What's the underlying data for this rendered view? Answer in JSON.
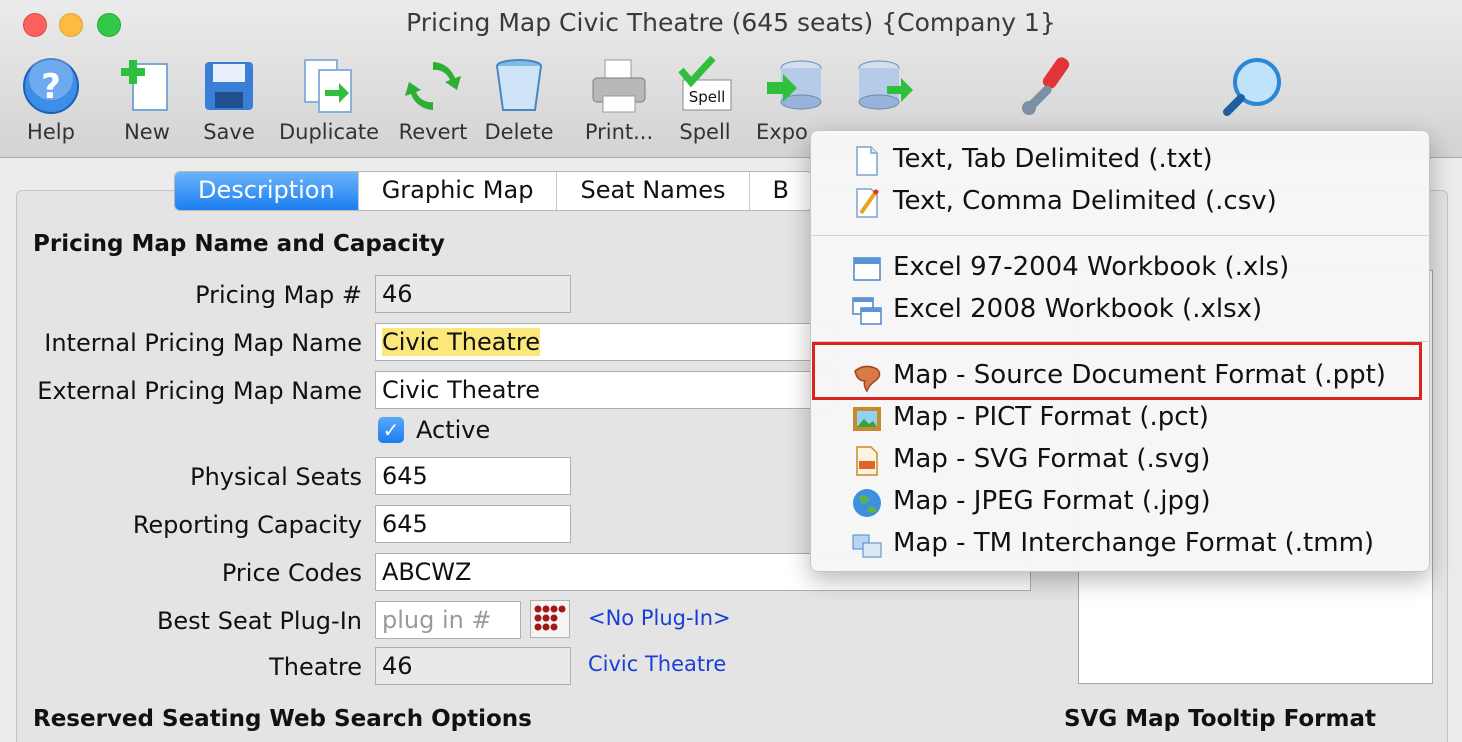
{
  "window": {
    "title": "Pricing Map Civic Theatre (645 seats) {Company 1}"
  },
  "toolbar": {
    "help": "Help",
    "new": "New",
    "save": "Save",
    "duplicate": "Duplicate",
    "revert": "Revert",
    "delete": "Delete",
    "print": "Print...",
    "spell": "Spell",
    "export": "Expo",
    "spell_badge": "Spell"
  },
  "tabs": [
    "Description",
    "Graphic Map",
    "Seat Names",
    "B"
  ],
  "sections": {
    "capacity": "Pricing Map Name and Capacity",
    "web_search": "Reserved Seating Web Search Options",
    "svg_tooltip": "SVG Map Tooltip Format"
  },
  "fields": {
    "pricing_map_no": {
      "label": "Pricing Map #",
      "value": "46"
    },
    "internal_name": {
      "label": "Internal Pricing Map Name",
      "value": "Civic Theatre"
    },
    "external_name": {
      "label": "External Pricing Map Name",
      "value": "Civic Theatre"
    },
    "active": {
      "label": "Active",
      "checked": true
    },
    "physical_seats": {
      "label": "Physical Seats",
      "value": "645"
    },
    "reporting_capacity": {
      "label": "Reporting Capacity",
      "value": "645"
    },
    "price_codes": {
      "label": "Price Codes",
      "value": "ABCWZ"
    },
    "best_seat": {
      "label": "Best Seat Plug-In",
      "placeholder": "plug in #",
      "link": "<No Plug-In>"
    },
    "theatre": {
      "label": "Theatre",
      "value": "46",
      "link": "Civic Theatre"
    }
  },
  "export_menu": {
    "items": [
      {
        "label": "Text, Tab Delimited (.txt)",
        "icon": "text-file-icon"
      },
      {
        "label": "Text, Comma Delimited (.csv)",
        "icon": "text-edit-icon"
      },
      {
        "label": "Excel 97-2004 Workbook (.xls)",
        "icon": "window-icon"
      },
      {
        "label": "Excel 2008 Workbook (.xlsx)",
        "icon": "windows-icon"
      },
      {
        "label": "Map - Source Document Format (.ppt)",
        "icon": "source-doc-icon",
        "highlighted": true
      },
      {
        "label": "Map - PICT Format (.pct)",
        "icon": "picture-icon"
      },
      {
        "label": "Map - SVG Format  (.svg)",
        "icon": "svg-file-icon"
      },
      {
        "label": "Map - JPEG Format (.jpg)",
        "icon": "globe-icon"
      },
      {
        "label": "Map - TM Interchange Format (.tmm)",
        "icon": "interchange-icon"
      }
    ],
    "highlight_color": "#d8261f"
  }
}
